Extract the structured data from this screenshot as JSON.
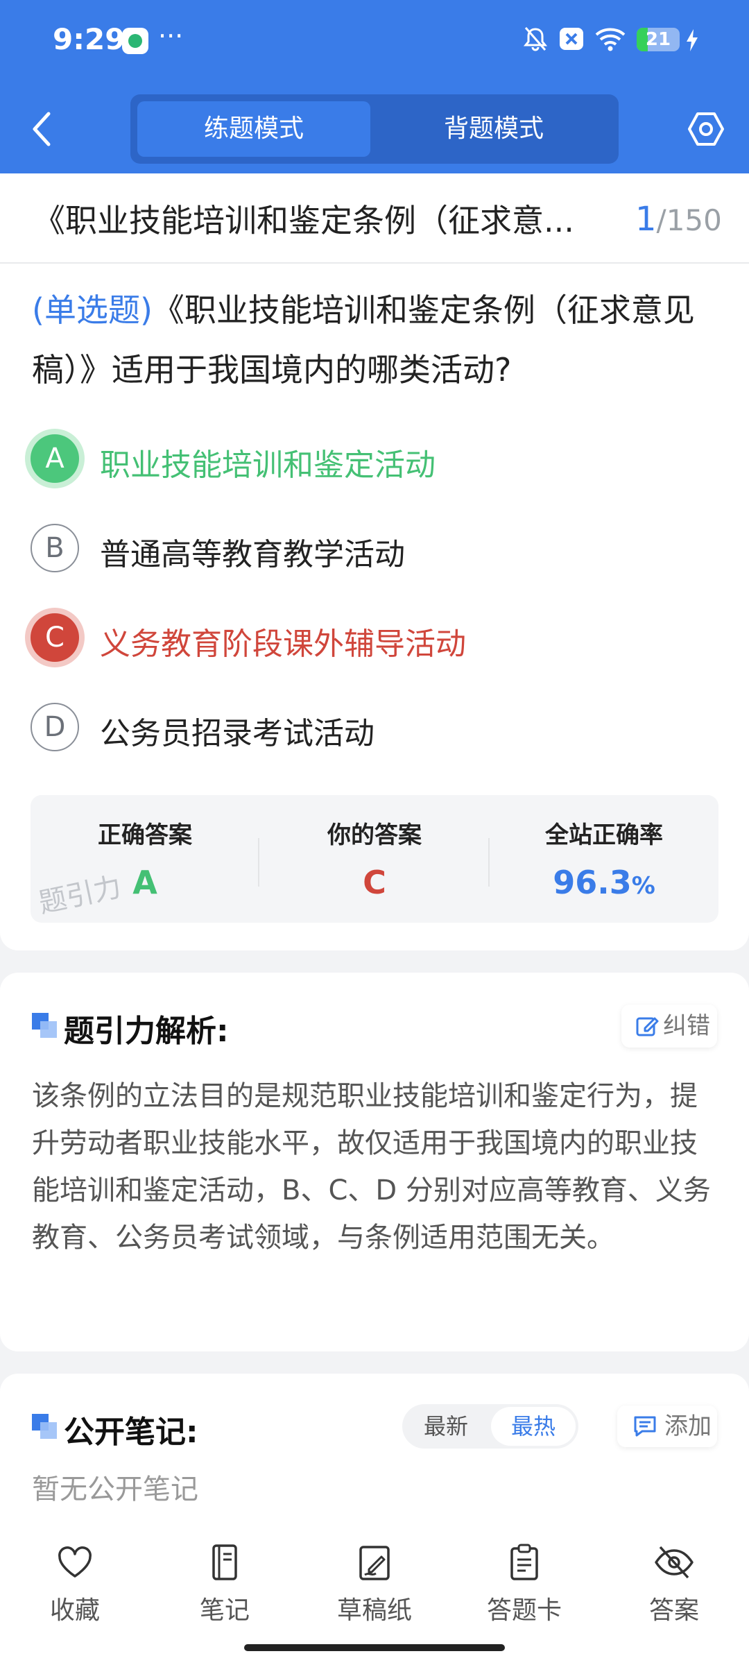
{
  "status_bar": {
    "time": "9:29",
    "more": "···",
    "battery": "21"
  },
  "header": {
    "mode_practice": "练题模式",
    "mode_memorize": "背题模式"
  },
  "paper": {
    "title": "《职业技能培训和鉴定条例（征求意...",
    "current": "1",
    "total": "/150"
  },
  "question": {
    "type": "(单选题)",
    "text": "《职业技能培训和鉴定条例（征求意见稿）》适用于我国境内的哪类活动?",
    "options": [
      {
        "letter": "A",
        "text": "职业技能培训和鉴定活动",
        "state": "correct"
      },
      {
        "letter": "B",
        "text": "普通高等教育教学活动",
        "state": "normal"
      },
      {
        "letter": "C",
        "text": "义务教育阶段课外辅导活动",
        "state": "wrong"
      },
      {
        "letter": "D",
        "text": "公务员招录考试活动",
        "state": "normal"
      }
    ]
  },
  "stats": {
    "correct_label": "正确答案",
    "correct_value": "A",
    "yours_label": "你的答案",
    "yours_value": "C",
    "rate_label": "全站正确率",
    "rate_value": "96.3",
    "rate_unit": "%",
    "watermark": "题引力"
  },
  "analysis": {
    "title": "题引力解析:",
    "report_label": "纠错",
    "text": "该条例的立法目的是规范职业技能培训和鉴定行为，提升劳动者职业技能水平，故仅适用于我国境内的职业技能培训和鉴定活动，B、C、D 分别对应高等教育、义务教育、公务员考试领域，与条例适用范围无关。"
  },
  "notes": {
    "title": "公开笔记:",
    "sort_new": "最新",
    "sort_hot": "最热",
    "add_label": "添加",
    "empty": "暂无公开笔记"
  },
  "bottom_tabs": [
    {
      "label": "收藏",
      "icon": "heart-icon"
    },
    {
      "label": "笔记",
      "icon": "notebook-icon"
    },
    {
      "label": "草稿纸",
      "icon": "draft-icon"
    },
    {
      "label": "答题卡",
      "icon": "answer-sheet-icon"
    },
    {
      "label": "答案",
      "icon": "eye-off-icon"
    }
  ],
  "colors": {
    "accent": "#3a7ce8",
    "correct": "#44c074",
    "wrong": "#d0463b"
  }
}
